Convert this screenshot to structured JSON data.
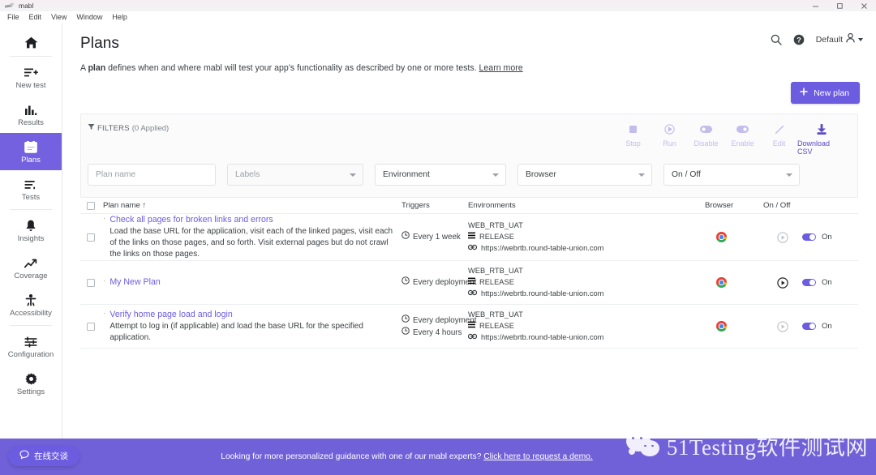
{
  "window": {
    "app_title": "mabl",
    "menu": [
      "File",
      "Edit",
      "View",
      "Window",
      "Help"
    ],
    "controls": [
      "minimize",
      "maximize",
      "close"
    ]
  },
  "sidebar": {
    "items": [
      {
        "label": "",
        "icon": "home-icon",
        "name": "home",
        "active": false
      },
      {
        "label": "New test",
        "icon": "new-test-icon",
        "name": "new-test",
        "active": false
      },
      {
        "label": "Results",
        "icon": "results-icon",
        "name": "results",
        "active": false
      },
      {
        "label": "Plans",
        "icon": "plans-icon",
        "name": "plans",
        "active": true
      },
      {
        "label": "Tests",
        "icon": "tests-icon",
        "name": "tests",
        "active": false
      },
      {
        "label": "Insights",
        "icon": "insights-icon",
        "name": "insights",
        "active": false
      },
      {
        "label": "Coverage",
        "icon": "coverage-icon",
        "name": "coverage",
        "active": false
      },
      {
        "label": "Accessibility",
        "icon": "accessibility-icon",
        "name": "accessibility",
        "active": false
      },
      {
        "label": "Configuration",
        "icon": "configuration-icon",
        "name": "configuration",
        "active": false
      },
      {
        "label": "Settings",
        "icon": "settings-icon",
        "name": "settings",
        "active": false
      }
    ]
  },
  "header": {
    "title": "Plans",
    "search_icon": "search-icon",
    "help_icon": "help-circle-icon",
    "account_label": "Default",
    "account_icon": "person-icon"
  },
  "description": {
    "prefix": "A ",
    "bold": "plan",
    "rest": " defines when and where mabl will test your app’s functionality as described by one or more tests. ",
    "link": "Learn more"
  },
  "new_plan_button": {
    "label": "New plan",
    "icon": "plus-icon"
  },
  "filters": {
    "toggle_label": "FILTERS",
    "applied_count": "(0 Applied)",
    "fields": [
      {
        "name": "plan-name",
        "placeholder": "Plan name",
        "value": "",
        "type": "text"
      },
      {
        "name": "labels",
        "placeholder": "Labels",
        "value": "",
        "type": "select"
      },
      {
        "name": "environment",
        "placeholder": "Environment",
        "value": "Environment",
        "type": "select"
      },
      {
        "name": "browser",
        "placeholder": "Browser",
        "value": "Browser",
        "type": "select"
      },
      {
        "name": "on-off",
        "placeholder": "On / Off",
        "value": "On / Off",
        "type": "select"
      }
    ]
  },
  "toolbar": {
    "actions": [
      {
        "label": "Stop",
        "icon": "stop-icon",
        "enabled": false
      },
      {
        "label": "Run",
        "icon": "play-circle-icon",
        "enabled": false
      },
      {
        "label": "Disable",
        "icon": "toggle-off-icon",
        "enabled": false
      },
      {
        "label": "Enable",
        "icon": "toggle-on-icon",
        "enabled": false
      },
      {
        "label": "Edit",
        "icon": "pencil-icon",
        "enabled": false
      },
      {
        "label": "Download CSV",
        "icon": "download-icon",
        "enabled": true
      }
    ]
  },
  "table": {
    "columns": [
      "Plan name ↑",
      "Triggers",
      "Environments",
      "Browser",
      "On / Off"
    ],
    "rows": [
      {
        "name": "Check all pages for broken links and errors",
        "description": "Load the base URL for the application, visit each of the linked pages, visit each of the links on those pages, and so forth. Visit external pages but do not crawl the links on those pages.",
        "triggers": [
          "Every 1 week"
        ],
        "environment": "WEB_RTB_UAT",
        "release": "RELEASE",
        "url": "https://webrtb.round-table-union.com",
        "browser": "chrome-icon",
        "run_enabled": false,
        "toggle_state": "On"
      },
      {
        "name": "My New Plan",
        "description": "",
        "triggers": [
          "Every deployment"
        ],
        "environment": "WEB_RTB_UAT",
        "release": "RELEASE",
        "url": "https://webrtb.round-table-union.com",
        "browser": "chrome-icon",
        "run_enabled": true,
        "toggle_state": "On"
      },
      {
        "name": "Verify home page load and login",
        "description": "Attempt to log in (if applicable) and load the base URL for the specified application.",
        "triggers": [
          "Every deployment",
          "Every 4 hours"
        ],
        "environment": "WEB_RTB_UAT",
        "release": "RELEASE",
        "url": "https://webrtb.round-table-union.com",
        "browser": "chrome-icon",
        "run_enabled": false,
        "toggle_state": "On"
      }
    ]
  },
  "banner": {
    "text": "Looking for more personalized guidance with one of our mabl experts? ",
    "link": "Click here to request a demo."
  },
  "chat_widget": {
    "label": "在线交谈",
    "icon": "chat-bubble-icon"
  },
  "watermark": {
    "text": "51Testing软件测试网",
    "icon": "wechat-icon"
  },
  "colors": {
    "accent": "#6c5ce0",
    "banner": "#7161d8",
    "sidebar_active": "#7461e0"
  }
}
